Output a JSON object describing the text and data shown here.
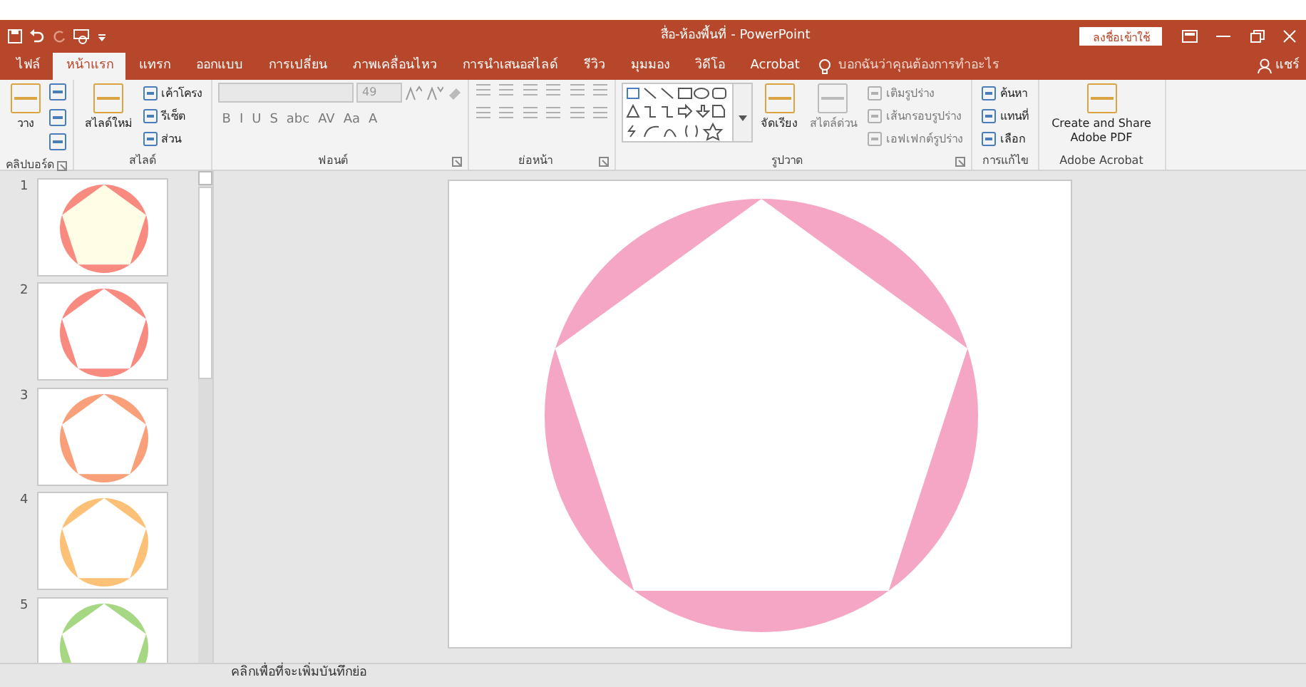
{
  "window": {
    "title": "สื่อ-ห้องพื้นที่ - PowerPoint",
    "sign_in": "ลงชื่อเข้าใช้"
  },
  "tabs": [
    {
      "label": "ไฟล์",
      "selected": false
    },
    {
      "label": "หน้าแรก",
      "selected": true
    },
    {
      "label": "แทรก",
      "selected": false
    },
    {
      "label": "ออกแบบ",
      "selected": false
    },
    {
      "label": "การเปลี่ยน",
      "selected": false
    },
    {
      "label": "ภาพเคลื่อนไหว",
      "selected": false
    },
    {
      "label": "การนำเสนอสไลด์",
      "selected": false
    },
    {
      "label": "รีวิว",
      "selected": false
    },
    {
      "label": "มุมมอง",
      "selected": false
    },
    {
      "label": "วิดีโอ",
      "selected": false
    },
    {
      "label": "Acrobat",
      "selected": false
    }
  ],
  "tell_me": {
    "placeholder": "บอกฉันว่าคุณต้องการทำอะไร"
  },
  "share": "แชร์",
  "ribbon": [
    {
      "label": "คลิปบอร์ด",
      "launcher": true,
      "columns": [
        [
          {
            "kind": "large",
            "label": "วาง",
            "disabled": false
          }
        ],
        [
          {
            "kind": "icon",
            "disabled": false
          },
          {
            "kind": "icon",
            "disabled": false
          },
          {
            "kind": "icon",
            "disabled": false
          }
        ]
      ]
    },
    {
      "label": "สไลด์",
      "launcher": false,
      "columns": [
        [
          {
            "kind": "large",
            "label": "สไลด์ใหม่",
            "disabled": false
          }
        ],
        [
          {
            "kind": "small",
            "label": "เค้าโครง",
            "disabled": false
          },
          {
            "kind": "small",
            "label": "รีเซ็ต",
            "disabled": false
          },
          {
            "kind": "small",
            "label": "ส่วน",
            "disabled": false
          }
        ]
      ]
    },
    {
      "label": "ฟอนต์",
      "launcher": true,
      "columns": [
        [
          {
            "kind": "fonts",
            "size": "49",
            "disabled": true
          },
          {
            "kind": "glyphs",
            "glyphs": [
              "B",
              "I",
              "U",
              "S",
              "abc",
              "AV",
              "Aa",
              "A"
            ],
            "disabled": true
          }
        ]
      ]
    },
    {
      "label": "ย่อหน้า",
      "launcher": true,
      "columns": [
        [
          {
            "kind": "icons",
            "disabled": true
          },
          {
            "kind": "icons",
            "disabled": true
          }
        ]
      ]
    },
    {
      "label": "รูปวาด",
      "launcher": true,
      "columns": [
        [
          {
            "kind": "gallery"
          }
        ],
        [
          {
            "kind": "large",
            "label": "จัดเรียง",
            "disabled": false
          }
        ],
        [
          {
            "kind": "large",
            "label": "สไตล์ด่วน",
            "disabled": true
          }
        ],
        [
          {
            "kind": "small",
            "label": "เติมรูปร่าง",
            "disabled": true
          },
          {
            "kind": "small",
            "label": "เส้นกรอบรูปร่าง",
            "disabled": true
          },
          {
            "kind": "small",
            "label": "เอฟเฟกต์รูปร่าง",
            "disabled": true
          }
        ]
      ]
    },
    {
      "label": "การแก้ไข",
      "launcher": false,
      "columns": [
        [
          {
            "kind": "small",
            "label": "ค้นหา",
            "disabled": false
          },
          {
            "kind": "small",
            "label": "แทนที่",
            "disabled": false
          },
          {
            "kind": "small",
            "label": "เลือก",
            "disabled": false
          }
        ]
      ]
    },
    {
      "label": "Adobe Acrobat",
      "launcher": false,
      "columns": [
        [
          {
            "kind": "large",
            "label": "Create and Share Adobe PDF",
            "disabled": false
          }
        ]
      ]
    }
  ],
  "slides": [
    {
      "number": "1",
      "shapes": [
        {
          "kind": "circle",
          "color": "#f98a80"
        },
        {
          "kind": "pentagon",
          "color": "#fffde6"
        }
      ]
    },
    {
      "number": "2",
      "shapes": [
        {
          "kind": "circle",
          "color": "#f98a80"
        },
        {
          "kind": "pentagon",
          "color": "#ffffff"
        }
      ]
    },
    {
      "number": "3",
      "shapes": [
        {
          "kind": "circle",
          "color": "#f9a07a"
        },
        {
          "kind": "pentagon",
          "color": "#ffffff"
        }
      ]
    },
    {
      "number": "4",
      "shapes": [
        {
          "kind": "circle",
          "color": "#fcc177"
        },
        {
          "kind": "pentagon",
          "color": "#ffffff"
        }
      ]
    },
    {
      "number": "5",
      "shapes": [
        {
          "kind": "circle",
          "color": "#a6d884"
        },
        {
          "kind": "pentagon",
          "color": "#ffffff"
        }
      ]
    }
  ],
  "current_slide": {
    "shapes": [
      {
        "kind": "circle",
        "color": "#f4a6c4"
      },
      {
        "kind": "pentagon",
        "color": "#ffffff"
      }
    ]
  },
  "notes": {
    "placeholder": "คลิกเพื่อที่จะเพิ่มบันทึกย่อ"
  }
}
